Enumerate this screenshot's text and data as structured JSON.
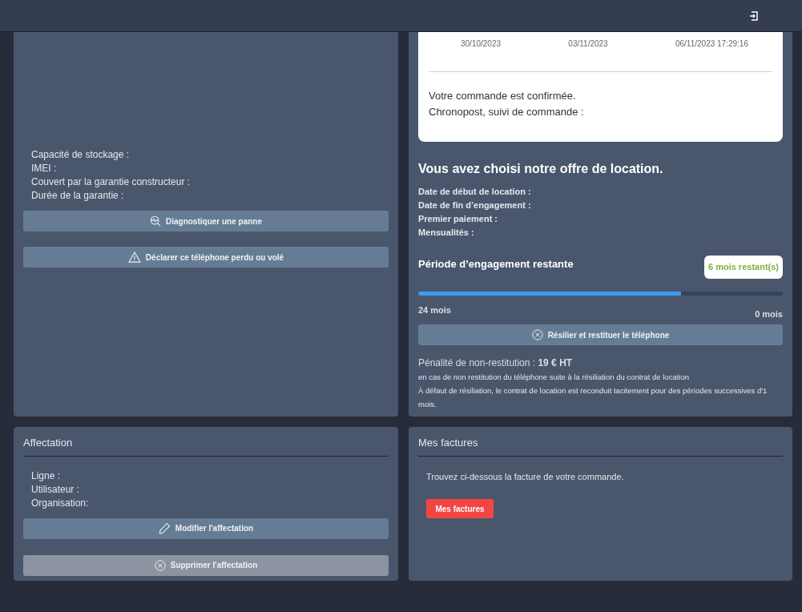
{
  "device": {
    "fields": [
      "Capacité de stockage :",
      "IMEI :",
      "Couvert par la garantie constructeur :",
      "Durée de la garantie :"
    ],
    "buttons": [
      {
        "label": "Diagnostiquer une panne"
      },
      {
        "label": "Déclarer ce téléphone perdu ou volé"
      }
    ]
  },
  "order": {
    "dates": [
      "30/10/2023",
      "03/11/2023",
      "06/11/2023 17:29:16"
    ],
    "messages": [
      "Votre commande est confirmée.",
      "Chronopost, suivi de commande :"
    ]
  },
  "rental": {
    "title": "Vous avez choisi notre offre de location.",
    "fields": [
      "Date de début de location :",
      "Date de fin d’engagement :",
      "Premier paiement :",
      "Mensualités :"
    ],
    "period_title": "Période d’engagement restante",
    "remaining": "6 mois restant(s)",
    "level": 0.72,
    "start_label": "24 mois",
    "end_label": "0 mois",
    "button": {
      "label": "Résilier et restituer le téléphone"
    },
    "penalty": "Pénalité de non-restitution : **19 € HT**",
    "notes": [
      "en cas de non restitution du téléphone suite à la résiliation du contrat de location",
      "À défaut de résiliation, le contrat de location est reconduit tacitement pour des périodes successives d'1 mois."
    ]
  },
  "assignment": {
    "title": "Affectation",
    "fields": [
      "Ligne :",
      "Utilisateur :",
      "Organisation:"
    ],
    "buttons": [
      {
        "label": "Modifier l'affectation",
        "disabled": false
      },
      {
        "label": "Supprimer l'affectation",
        "disabled": true
      }
    ]
  },
  "invoices": {
    "title": "Mes factures",
    "text": "Trouvez ci-dessous la facture de votre commande.",
    "button": "Mes factures"
  }
}
